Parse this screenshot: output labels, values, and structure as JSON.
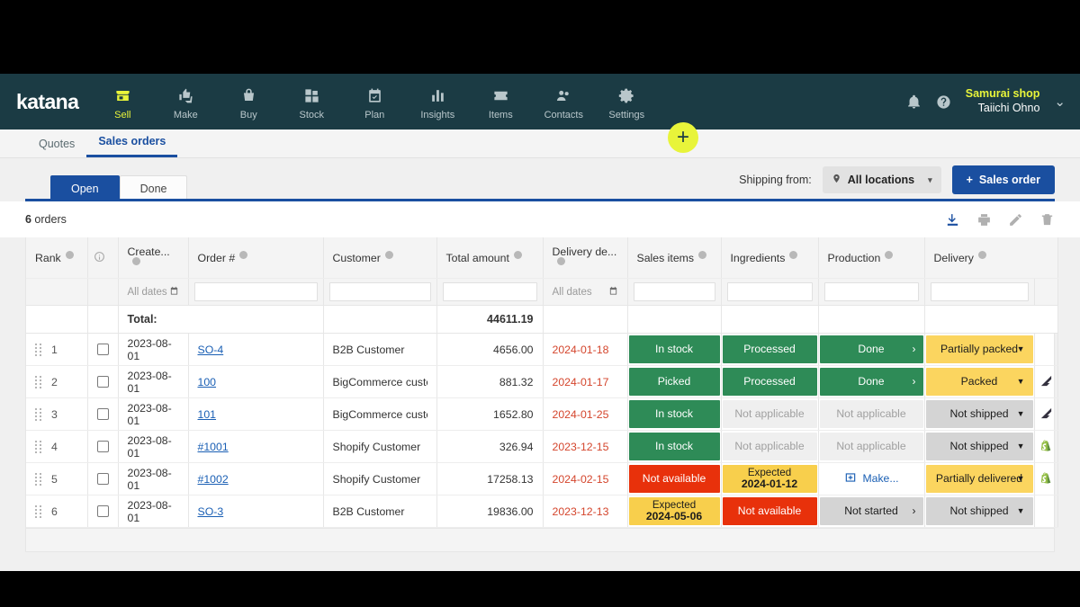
{
  "brand": {
    "name": "katana"
  },
  "topnav": {
    "items": [
      {
        "label": "Sell",
        "icon": "store-icon",
        "active": true
      },
      {
        "label": "Make",
        "icon": "thumbs-icon",
        "active": false
      },
      {
        "label": "Buy",
        "icon": "basket-icon",
        "active": false
      },
      {
        "label": "Stock",
        "icon": "grid-icon",
        "active": false
      },
      {
        "label": "Plan",
        "icon": "calendar-check-icon",
        "active": false
      },
      {
        "label": "Insights",
        "icon": "bar-chart-icon",
        "active": false
      },
      {
        "label": "Items",
        "icon": "ticket-star-icon",
        "active": false
      },
      {
        "label": "Contacts",
        "icon": "people-icon",
        "active": false
      },
      {
        "label": "Settings",
        "icon": "gear-icon",
        "active": false
      }
    ],
    "notifications_icon": "bell-icon",
    "help_icon": "question-circle-icon",
    "user": {
      "shop": "Samurai shop",
      "person": "Taiichi Ohno"
    },
    "chevron": "⌄",
    "fab_label": "+"
  },
  "subnav": {
    "tabs": [
      {
        "label": "Quotes",
        "active": false
      },
      {
        "label": "Sales orders",
        "active": true
      }
    ]
  },
  "toolbar": {
    "tabs": [
      {
        "label": "Open",
        "active": true
      },
      {
        "label": "Done",
        "active": false
      }
    ],
    "shipping_label": "Shipping from:",
    "location_value": "All locations",
    "location_icon": "pin-icon",
    "location_caret": "▾",
    "new_order_label": "Sales order",
    "new_order_plus": "+"
  },
  "countbar": {
    "count": "6",
    "count_suffix": " orders",
    "actions": [
      {
        "name": "export-icon",
        "active": true
      },
      {
        "name": "print-icon",
        "active": false
      },
      {
        "name": "edit-icon",
        "active": false
      },
      {
        "name": "delete-icon",
        "active": false
      }
    ]
  },
  "table": {
    "columns": [
      {
        "key": "rank",
        "label": "Rank",
        "info": true
      },
      {
        "key": "select",
        "label": "",
        "info": false,
        "header_icon": "info-circle-icon"
      },
      {
        "key": "created",
        "label": "Create...",
        "info": true
      },
      {
        "key": "order",
        "label": "Order #",
        "info": true
      },
      {
        "key": "customer",
        "label": "Customer",
        "info": true
      },
      {
        "key": "total",
        "label": "Total amount",
        "info": true
      },
      {
        "key": "delivery_deadline",
        "label": "Delivery de...",
        "info": true
      },
      {
        "key": "sales_items",
        "label": "Sales items",
        "info": true
      },
      {
        "key": "ingredients",
        "label": "Ingredients",
        "info": true
      },
      {
        "key": "production",
        "label": "Production",
        "info": true
      },
      {
        "key": "delivery",
        "label": "Delivery",
        "info": true
      },
      {
        "key": "source",
        "label": "",
        "info": false
      }
    ],
    "filters": {
      "created_placeholder": "All dates",
      "deadline_placeholder": "All dates",
      "calendar_icon": "calendar-icon"
    },
    "total_label": "Total:",
    "total_value": "44611.19",
    "rows": [
      {
        "rank": "1",
        "created": "2023-08-01",
        "order": "SO-4",
        "customer": "B2B Customer",
        "total": "4656.00",
        "deadline": "2024-01-18",
        "sales_items": {
          "text": "In stock",
          "style": "green"
        },
        "ingredients": {
          "text": "Processed",
          "style": "green"
        },
        "production": {
          "text": "Done",
          "style": "green",
          "arrow": "›"
        },
        "delivery": {
          "text": "Partially packed",
          "style": "yellow",
          "dropdown": "▾"
        },
        "source": ""
      },
      {
        "rank": "2",
        "created": "2023-08-01",
        "order": "100",
        "customer": "BigCommerce customer",
        "total": "881.32",
        "deadline": "2024-01-17",
        "sales_items": {
          "text": "Picked",
          "style": "green"
        },
        "ingredients": {
          "text": "Processed",
          "style": "green"
        },
        "production": {
          "text": "Done",
          "style": "green",
          "arrow": "›"
        },
        "delivery": {
          "text": "Packed",
          "style": "yellow",
          "dropdown": "▾"
        },
        "source": "bigcommerce-icon"
      },
      {
        "rank": "3",
        "created": "2023-08-01",
        "order": "101",
        "customer": "BigCommerce customer",
        "total": "1652.80",
        "deadline": "2024-01-25",
        "sales_items": {
          "text": "In stock",
          "style": "green"
        },
        "ingredients": {
          "text": "Not applicable",
          "style": "grey"
        },
        "production": {
          "text": "Not applicable",
          "style": "grey"
        },
        "delivery": {
          "text": "Not shipped",
          "style": "grey-dark",
          "dropdown": "▾"
        },
        "source": "bigcommerce-icon"
      },
      {
        "rank": "4",
        "created": "2023-08-01",
        "order": "#1001",
        "customer": "Shopify Customer",
        "total": "326.94",
        "deadline": "2023-12-15",
        "sales_items": {
          "text": "In stock",
          "style": "green"
        },
        "ingredients": {
          "text": "Not applicable",
          "style": "grey"
        },
        "production": {
          "text": "Not applicable",
          "style": "grey"
        },
        "delivery": {
          "text": "Not shipped",
          "style": "grey-dark",
          "dropdown": "▾"
        },
        "source": "shopify-icon"
      },
      {
        "rank": "5",
        "created": "2023-08-01",
        "order": "#1002",
        "customer": "Shopify Customer",
        "total": "17258.13",
        "deadline": "2024-02-15",
        "sales_items": {
          "text": "Not available",
          "style": "red"
        },
        "ingredients": {
          "text": "Expected",
          "date": "2024-01-12",
          "style": "yellow2"
        },
        "production": {
          "text": "Make...",
          "style": "white",
          "icon": "make-icon"
        },
        "delivery": {
          "text": "Partially delivered",
          "style": "yellow",
          "dropdown": "▾"
        },
        "source": "shopify-icon"
      },
      {
        "rank": "6",
        "created": "2023-08-01",
        "order": "SO-3",
        "customer": "B2B Customer",
        "total": "19836.00",
        "deadline": "2023-12-13",
        "sales_items": {
          "text": "Expected",
          "date": "2024-05-06",
          "style": "yellow2"
        },
        "ingredients": {
          "text": "Not available",
          "style": "red"
        },
        "production": {
          "text": "Not started",
          "style": "grey-dark",
          "arrow": "›"
        },
        "delivery": {
          "text": "Not shipped",
          "style": "grey-dark",
          "dropdown": "▾"
        },
        "source": ""
      }
    ]
  },
  "colors": {
    "nav_bg": "#1b3b44",
    "accent_yellow": "#e8f43a",
    "primary_blue": "#1a4fa0",
    "status_green": "#2e8b57",
    "status_red": "#e8310b",
    "status_yellow": "#fbd55f",
    "deadline_red": "#d4452c"
  }
}
